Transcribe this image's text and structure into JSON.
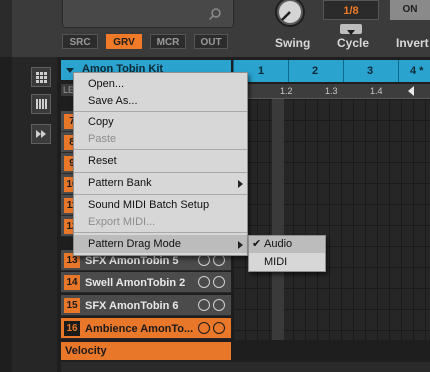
{
  "source_tabs": [
    {
      "label": "SRC",
      "active": false
    },
    {
      "label": "GRV",
      "active": true
    },
    {
      "label": "MCR",
      "active": false
    },
    {
      "label": "OUT",
      "active": false
    }
  ],
  "controls": {
    "swing_label": "Swing",
    "cycle_label": "Cycle",
    "cycle_value": "1/8",
    "invert_label": "Invert",
    "on_label": "ON"
  },
  "group": {
    "title": "Amon Tobin Kit",
    "le_label": "LE"
  },
  "sounds": [
    {
      "num": "7",
      "name": ""
    },
    {
      "num": "8",
      "name": ""
    },
    {
      "num": "9",
      "name": ""
    },
    {
      "num": "10",
      "name": ""
    },
    {
      "num": "11",
      "name": ""
    },
    {
      "num": "12",
      "name": ""
    },
    {
      "num": "13",
      "name": "SFX AmonTobin 5"
    },
    {
      "num": "14",
      "name": "Swell AmonTobin 2"
    },
    {
      "num": "15",
      "name": "SFX AmonTobin 6"
    },
    {
      "num": "16",
      "name": "Ambience AmonTo..."
    }
  ],
  "velocity_label": "Velocity",
  "timeline": {
    "bars": [
      "1",
      "2",
      "3",
      "4 *"
    ],
    "ruler": [
      "1.2",
      "1.3",
      "1.4"
    ]
  },
  "context_menu": {
    "items": [
      {
        "label": "Open...",
        "enabled": true
      },
      {
        "label": "Save As...",
        "enabled": true
      },
      {
        "label": "Copy",
        "enabled": true
      },
      {
        "label": "Paste",
        "enabled": false
      },
      {
        "label": "Reset",
        "enabled": true
      },
      {
        "label": "Pattern Bank",
        "enabled": true,
        "submenu": true
      },
      {
        "label": "Sound MIDI Batch Setup",
        "enabled": true
      },
      {
        "label": "Export MIDI...",
        "enabled": false
      },
      {
        "label": "Pattern Drag Mode",
        "enabled": true,
        "submenu": true,
        "highlighted": true
      }
    ]
  },
  "submenu": {
    "items": [
      {
        "label": "Audio",
        "checked": true
      },
      {
        "label": "MIDI",
        "checked": false
      }
    ]
  },
  "colors": {
    "accent_orange": "#e9772a",
    "accent_blue": "#2aa3cf",
    "menu_bg": "#d7d7d7"
  }
}
